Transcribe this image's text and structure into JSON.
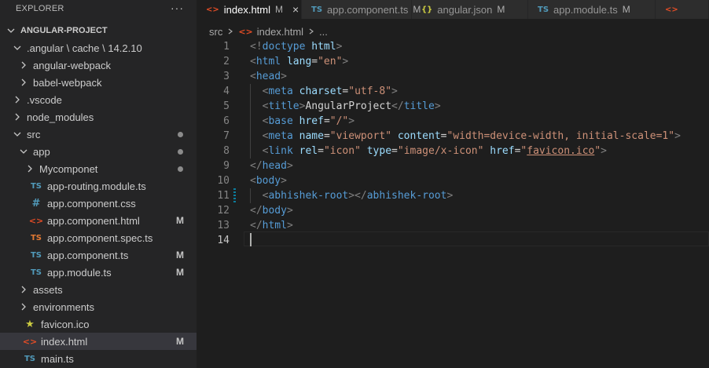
{
  "sidebar": {
    "title": "EXPLORER",
    "more_label": "···",
    "project": "ANGULAR-PROJECT",
    "tree": [
      {
        "label": ".angular \\ cache \\ 14.2.10",
        "type": "folder-open",
        "depth": 1
      },
      {
        "label": "angular-webpack",
        "type": "folder",
        "depth": 2
      },
      {
        "label": "babel-webpack",
        "type": "folder",
        "depth": 2
      },
      {
        "label": ".vscode",
        "type": "folder",
        "depth": 1
      },
      {
        "label": "node_modules",
        "type": "folder",
        "depth": 1
      },
      {
        "label": "src",
        "type": "folder-open",
        "depth": 1,
        "status": "dot"
      },
      {
        "label": "app",
        "type": "folder-open",
        "depth": 2,
        "status": "dot"
      },
      {
        "label": "Mycomponet",
        "type": "folder",
        "depth": 3,
        "status": "dot"
      },
      {
        "label": "app-routing.module.ts",
        "type": "file",
        "icon": "TS",
        "icon_kind": "ts",
        "depth": 3
      },
      {
        "label": "app.component.css",
        "type": "file",
        "icon": "#",
        "icon_kind": "css",
        "depth": 3
      },
      {
        "label": "app.component.html",
        "type": "file",
        "icon": "<>",
        "icon_kind": "html",
        "depth": 3,
        "status": "M"
      },
      {
        "label": "app.component.spec.ts",
        "type": "file",
        "icon": "TS",
        "icon_kind": "spec",
        "depth": 3
      },
      {
        "label": "app.component.ts",
        "type": "file",
        "icon": "TS",
        "icon_kind": "ts",
        "depth": 3,
        "status": "M"
      },
      {
        "label": "app.module.ts",
        "type": "file",
        "icon": "TS",
        "icon_kind": "ts",
        "depth": 3,
        "status": "M"
      },
      {
        "label": "assets",
        "type": "folder",
        "depth": 2
      },
      {
        "label": "environments",
        "type": "folder",
        "depth": 2
      },
      {
        "label": "favicon.ico",
        "type": "file",
        "icon": "★",
        "icon_kind": "star",
        "depth": 2
      },
      {
        "label": "index.html",
        "type": "file",
        "icon": "<>",
        "icon_kind": "html",
        "depth": 2,
        "status": "M",
        "active": true
      },
      {
        "label": "main.ts",
        "type": "file",
        "icon": "TS",
        "icon_kind": "ts",
        "depth": 2
      }
    ]
  },
  "tabs": [
    {
      "label": "index.html",
      "icon": "<>",
      "icon_kind": "html",
      "modified": "M",
      "active": true,
      "close": "×"
    },
    {
      "label": "app.component.ts",
      "icon": "TS",
      "icon_kind": "ts",
      "modified": "M"
    },
    {
      "label": "angular.json",
      "icon": "{}",
      "icon_kind": "json",
      "modified": "M"
    },
    {
      "label": "app.module.ts",
      "icon": "TS",
      "icon_kind": "ts",
      "modified": "M"
    },
    {
      "label": "",
      "icon": "<>",
      "icon_kind": "html",
      "modified": ""
    }
  ],
  "breadcrumb": [
    "src",
    "index.html",
    "..."
  ],
  "editor": {
    "active_line": 14,
    "lines": [
      [
        [
          "tg",
          "<!"
        ],
        [
          "tn",
          "doctype "
        ],
        [
          "at",
          "html"
        ],
        [
          "tg",
          ">"
        ]
      ],
      [
        [
          "tg",
          "<"
        ],
        [
          "tn",
          "html "
        ],
        [
          "at",
          "lang"
        ],
        [
          "tx",
          "="
        ],
        [
          "av",
          "\"en\""
        ],
        [
          "tg",
          ">"
        ]
      ],
      [
        [
          "tg",
          "<"
        ],
        [
          "tn",
          "head"
        ],
        [
          "tg",
          ">"
        ]
      ],
      [
        [
          "tx",
          "  "
        ],
        [
          "tg",
          "<"
        ],
        [
          "tn",
          "meta "
        ],
        [
          "at",
          "charset"
        ],
        [
          "tx",
          "="
        ],
        [
          "av",
          "\"utf-8\""
        ],
        [
          "tg",
          ">"
        ]
      ],
      [
        [
          "tx",
          "  "
        ],
        [
          "tg",
          "<"
        ],
        [
          "tn",
          "title"
        ],
        [
          "tg",
          ">"
        ],
        [
          "tx",
          "AngularProject"
        ],
        [
          "tg",
          "</"
        ],
        [
          "tn",
          "title"
        ],
        [
          "tg",
          ">"
        ]
      ],
      [
        [
          "tx",
          "  "
        ],
        [
          "tg",
          "<"
        ],
        [
          "tn",
          "base "
        ],
        [
          "at",
          "href"
        ],
        [
          "tx",
          "="
        ],
        [
          "av",
          "\"/\""
        ],
        [
          "tg",
          ">"
        ]
      ],
      [
        [
          "tx",
          "  "
        ],
        [
          "tg",
          "<"
        ],
        [
          "tn",
          "meta "
        ],
        [
          "at",
          "name"
        ],
        [
          "tx",
          "="
        ],
        [
          "av",
          "\"viewport\" "
        ],
        [
          "at",
          "content"
        ],
        [
          "tx",
          "="
        ],
        [
          "av",
          "\"width=device-width, initial-scale=1\""
        ],
        [
          "tg",
          ">"
        ]
      ],
      [
        [
          "tx",
          "  "
        ],
        [
          "tg",
          "<"
        ],
        [
          "tn",
          "link "
        ],
        [
          "at",
          "rel"
        ],
        [
          "tx",
          "="
        ],
        [
          "av",
          "\"icon\" "
        ],
        [
          "at",
          "type"
        ],
        [
          "tx",
          "="
        ],
        [
          "av",
          "\"image/x-icon\" "
        ],
        [
          "at",
          "href"
        ],
        [
          "tx",
          "="
        ],
        [
          "av",
          "\""
        ],
        [
          "avu",
          "favicon.ico"
        ],
        [
          "av",
          "\""
        ],
        [
          "tg",
          ">"
        ]
      ],
      [
        [
          "tg",
          "</"
        ],
        [
          "tn",
          "head"
        ],
        [
          "tg",
          ">"
        ]
      ],
      [
        [
          "tg",
          "<"
        ],
        [
          "tn",
          "body"
        ],
        [
          "tg",
          ">"
        ]
      ],
      [
        [
          "tx",
          "  "
        ],
        [
          "tg",
          "<"
        ],
        [
          "tn",
          "abhishek-root"
        ],
        [
          "tg",
          "></"
        ],
        [
          "tn",
          "abhishek-root"
        ],
        [
          "tg",
          ">"
        ]
      ],
      [
        [
          "tg",
          "</"
        ],
        [
          "tn",
          "body"
        ],
        [
          "tg",
          ">"
        ]
      ],
      [
        [
          "tg",
          "</"
        ],
        [
          "tn",
          "html"
        ],
        [
          "tg",
          ">"
        ]
      ],
      []
    ]
  },
  "colors": {
    "editor_bg": "#1e1e1e",
    "sidebar_bg": "#252526",
    "tag_name": "#569cd6",
    "attribute": "#9cdcfe",
    "string": "#ce9178"
  }
}
